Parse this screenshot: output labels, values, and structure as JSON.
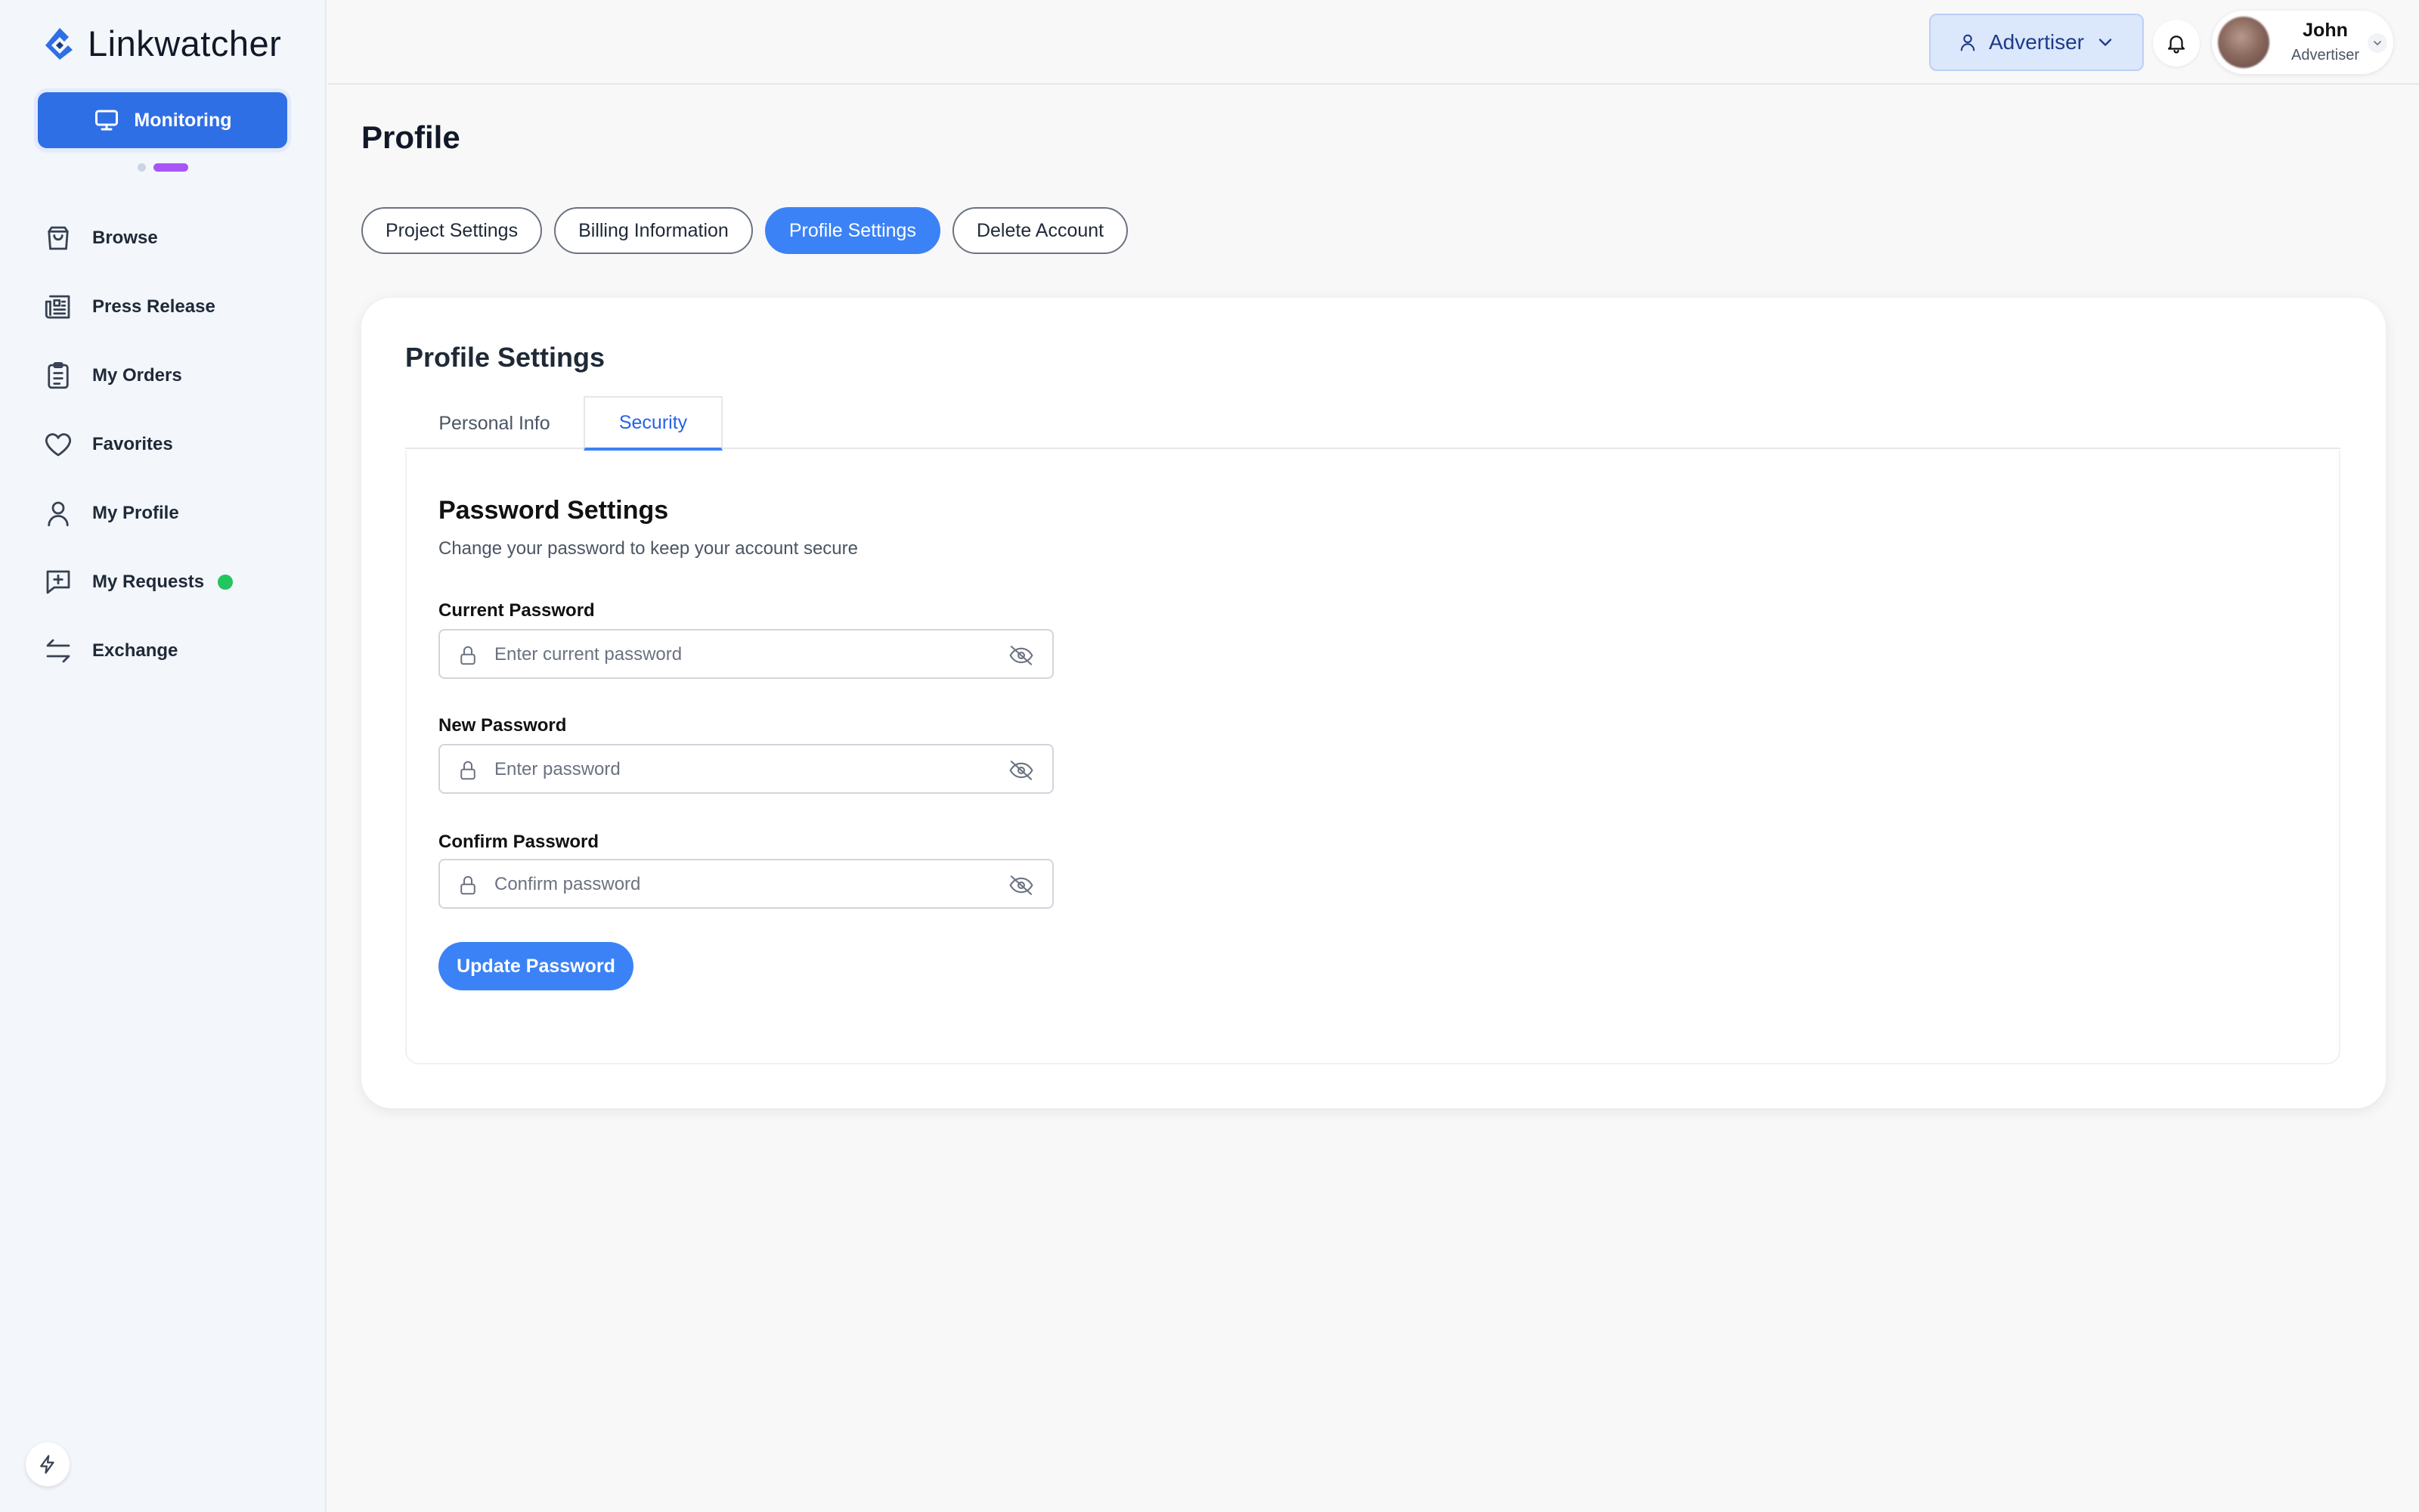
{
  "app": {
    "name": "Linkwatcher"
  },
  "sidebar": {
    "monitoring_label": "Monitoring",
    "items": [
      {
        "label": "Browse",
        "icon": "shopping-bag-icon"
      },
      {
        "label": "Press Release",
        "icon": "newspaper-icon"
      },
      {
        "label": "My Orders",
        "icon": "clipboard-icon"
      },
      {
        "label": "Favorites",
        "icon": "heart-icon"
      },
      {
        "label": "My Profile",
        "icon": "user-icon"
      },
      {
        "label": "My Requests",
        "icon": "message-plus-icon",
        "badge_color": "#22c55e"
      },
      {
        "label": "Exchange",
        "icon": "exchange-icon"
      }
    ]
  },
  "header": {
    "role_selector": "Advertiser",
    "user": {
      "name": "John",
      "role": "Advertiser"
    }
  },
  "page": {
    "title": "Profile",
    "tabs": [
      {
        "label": "Project Settings",
        "active": false
      },
      {
        "label": "Billing Information",
        "active": false
      },
      {
        "label": "Profile Settings",
        "active": true
      },
      {
        "label": "Delete Account",
        "active": false
      }
    ]
  },
  "card": {
    "title": "Profile Settings",
    "subtabs": [
      {
        "label": "Personal Info",
        "active": false
      },
      {
        "label": "Security",
        "active": true
      }
    ],
    "password": {
      "title": "Password Settings",
      "subtitle": "Change your password to keep your account secure",
      "current": {
        "label": "Current Password",
        "placeholder": "Enter current password"
      },
      "new": {
        "label": "New Password",
        "placeholder": "Enter password"
      },
      "confirm": {
        "label": "Confirm Password",
        "placeholder": "Confirm password"
      },
      "submit_label": "Update Password"
    }
  },
  "colors": {
    "primary": "#3b82f6",
    "brand": "#2f6fe6",
    "accent": "#a855f7",
    "success": "#22c55e"
  }
}
